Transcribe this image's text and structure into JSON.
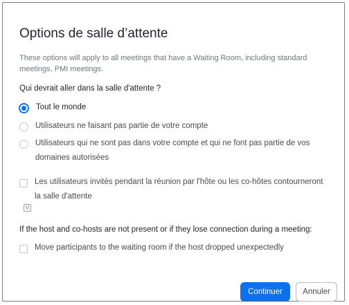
{
  "dialog": {
    "title": "Options de salle d’attente",
    "description": "These options will apply to all meetings that have a Waiting Room, including standard meetings, PMI meetings.",
    "question": "Qui devrait aller dans la salle d'attente ?",
    "radio_options": [
      {
        "label": "Tout le monde",
        "checked": true
      },
      {
        "label": "Utilisateurs ne faisant pas partie de votre compte",
        "checked": false
      },
      {
        "label": "Utilisateurs qui ne sont pas dans votre compte et qui ne font pas partie de vos domaines autorisées",
        "checked": false
      }
    ],
    "invited_bypass_label": "Les utilisateurs invités pendant la réunion par l'hôte ou les co-hôtes contourneront la salle d'attente",
    "small_icon_glyph": "V",
    "host_absent_label": "If the host and co-hosts are not present or if they lose connection during a meeting:",
    "move_participants_label": "Move participants to the waiting room if the host dropped unexpectedly",
    "continue_label": "Continuer",
    "cancel_label": "Annuler"
  },
  "colors": {
    "accent": "#0e71eb",
    "text": "#232333",
    "muted": "#6e7680",
    "border": "#c6c8cd"
  }
}
